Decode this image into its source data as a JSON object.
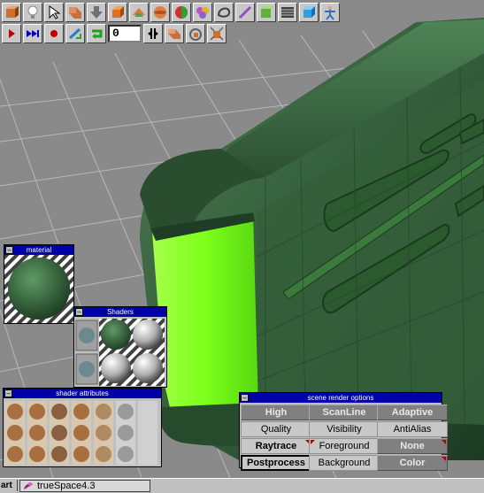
{
  "toolbar_top": {
    "icons": [
      "object-tool-icon",
      "light-icon",
      "pointer-icon",
      "eye-move-icon",
      "down-arrow-icon",
      "primitive-cube-icon",
      "paint-icon",
      "sphere-material-icon",
      "paint-brush-icon",
      "group-icon",
      "glue-icon",
      "deform-icon",
      "navigate-icon",
      "grid-icon",
      "view-cube-icon",
      "figure-icon"
    ]
  },
  "toolbar_anim": {
    "frame_value": "0",
    "icons": [
      "play-icon",
      "fast-forward-icon",
      "record-icon",
      "keyframe-icon",
      "loop-icon",
      "split-icon",
      "animation-path-icon",
      "rotate-anim-icon",
      "scale-anim-icon"
    ]
  },
  "material": {
    "title": "material"
  },
  "shaders": {
    "title": "Shaders"
  },
  "shader_attributes": {
    "title": "shader attributes"
  },
  "scene_render": {
    "title": "scene render options",
    "rows": [
      [
        {
          "label": "High",
          "style": "dark"
        },
        {
          "label": "ScanLine",
          "style": "dark"
        },
        {
          "label": "Adaptive",
          "style": "dark"
        }
      ],
      [
        {
          "label": "Quality",
          "style": "light"
        },
        {
          "label": "Visibility",
          "style": "light"
        },
        {
          "label": "AntiAlias",
          "style": "light"
        }
      ],
      [
        {
          "label": "Raytrace",
          "style": "light-bold"
        },
        {
          "label": "Foreground",
          "style": "light"
        },
        {
          "label": "None",
          "style": "dark"
        }
      ],
      [
        {
          "label": "Postprocess",
          "style": "light-bold-active"
        },
        {
          "label": "Background",
          "style": "light"
        },
        {
          "label": "Color",
          "style": "dark"
        }
      ]
    ]
  },
  "taskbar": {
    "start_label": "art",
    "task_label": "trueSpace4.3"
  },
  "colors": {
    "object_green": "#2f5a38",
    "glow_green": "#7cff1a",
    "title_blue": "#0000a8"
  }
}
